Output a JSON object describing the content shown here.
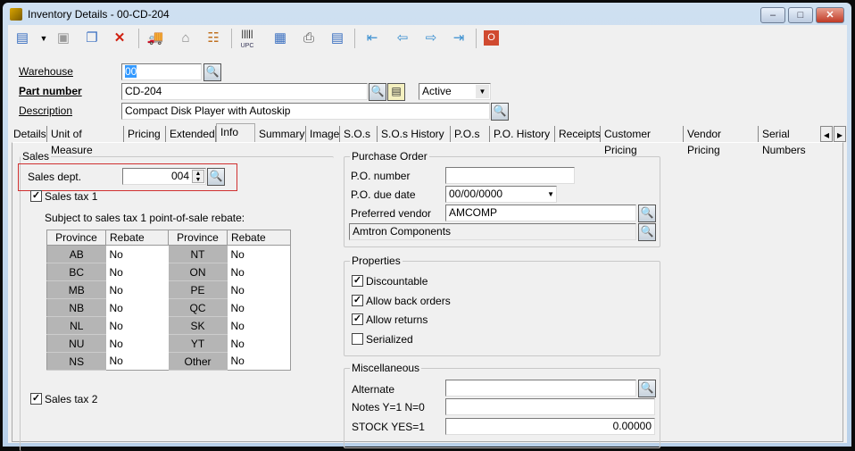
{
  "window": {
    "title": "Inventory Details - 00-CD-204",
    "minimize": "–",
    "maximize": "□",
    "close": "✕"
  },
  "toolbar": {
    "upc_label": "UPC"
  },
  "form": {
    "warehouse_label": "Warehouse",
    "warehouse_value": "00",
    "part_label": "Part number",
    "part_value": "CD-204",
    "status_value": "Active",
    "description_label": "Description",
    "description_value": "Compact Disk Player with Autoskip"
  },
  "tabs": [
    "Details",
    "Unit of Measure",
    "Pricing",
    "Extended",
    "Info",
    "Summary",
    "Image",
    "S.O.s",
    "S.O.s History",
    "P.O.s",
    "P.O. History",
    "Receipts",
    "Customer Pricing",
    "Vendor Pricing",
    "Serial Numbers"
  ],
  "active_tab": "Info",
  "sales": {
    "title": "Sales",
    "dept_label": "Sales dept.",
    "dept_value": "004",
    "tax1_label": "Sales tax 1",
    "tax1_checked": true,
    "rebate_label": "Subject to sales tax 1 point-of-sale rebate:",
    "headers": [
      "Province",
      "Rebate",
      "Province",
      "Rebate"
    ],
    "rows": [
      [
        "AB",
        "No",
        "NT",
        "No"
      ],
      [
        "BC",
        "No",
        "ON",
        "No"
      ],
      [
        "MB",
        "No",
        "PE",
        "No"
      ],
      [
        "NB",
        "No",
        "QC",
        "No"
      ],
      [
        "NL",
        "No",
        "SK",
        "No"
      ],
      [
        "NU",
        "No",
        "YT",
        "No"
      ],
      [
        "NS",
        "No",
        "Other",
        "No"
      ]
    ],
    "tax2_label": "Sales tax 2",
    "tax2_checked": true
  },
  "po": {
    "title": "Purchase Order",
    "number_label": "P.O. number",
    "number_value": "",
    "due_label": "P.O. due date",
    "due_value": "00/00/0000",
    "vendor_label": "Preferred vendor",
    "vendor_value": "AMCOMP",
    "vendor_name": "Amtron Components"
  },
  "properties": {
    "title": "Properties",
    "items": [
      {
        "label": "Discountable",
        "checked": true
      },
      {
        "label": "Allow back orders",
        "checked": true
      },
      {
        "label": "Allow returns",
        "checked": true
      },
      {
        "label": "Serialized",
        "checked": false
      }
    ]
  },
  "misc": {
    "title": "Miscellaneous",
    "alternate_label": "Alternate",
    "alternate_value": "",
    "notes_label": "Notes Y=1 N=0",
    "notes_value": "",
    "stock_label": "STOCK YES=1",
    "stock_value": "0.00000"
  },
  "colors": {
    "highlight_box": "#d03030",
    "titlebar": "#c4d8ee"
  }
}
